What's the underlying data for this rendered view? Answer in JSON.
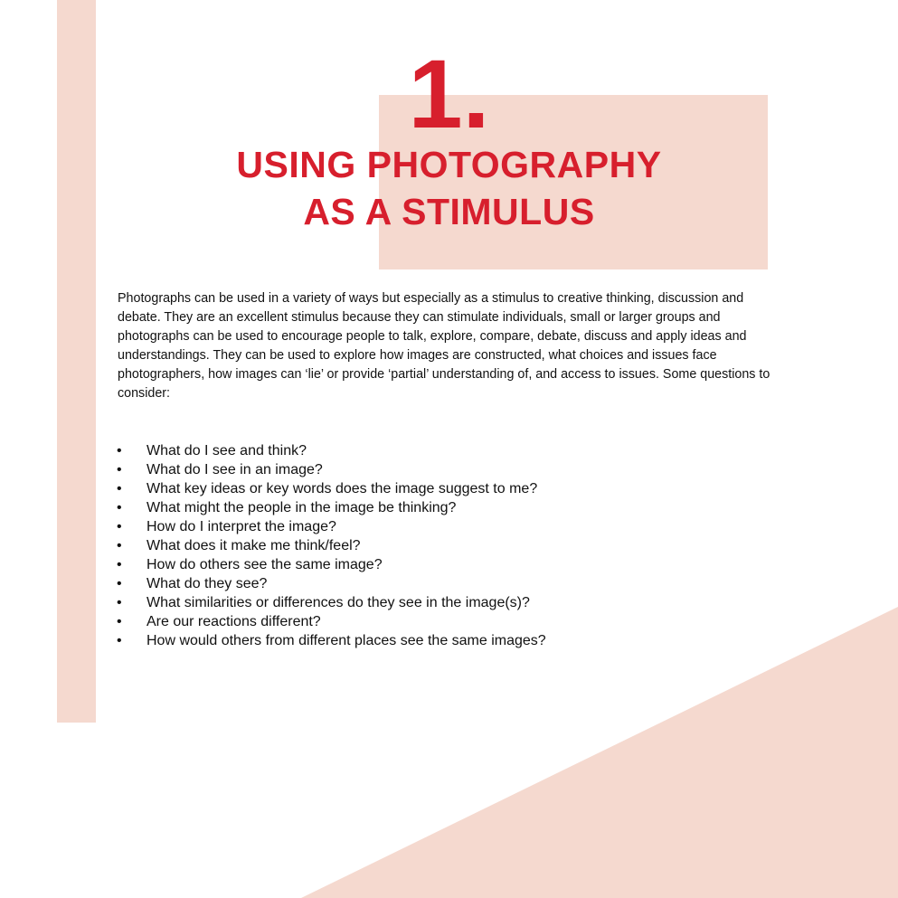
{
  "colors": {
    "accent_red": "#d71f2d",
    "accent_bg": "#f5d9cf",
    "text": "#111111",
    "background": "#ffffff"
  },
  "heading": {
    "number": "1.",
    "line1": "USING PHOTOGRAPHY",
    "line2": "AS A STIMULUS"
  },
  "intro": "Photographs can be used in a variety of ways but especially as a stimulus to creative thinking, discussion and debate. They are an excellent stimulus because they can stimulate individuals, small or larger groups and photographs can be used to encourage people to talk, explore, compare, debate, discuss and apply ideas and understandings. They can be used to explore how images are constructed, what choices and issues face photographers, how images can ‘lie’ or provide ‘partial’ understanding of, and access to issues. Some questions to consider:",
  "bullet_symbol": "•",
  "questions": [
    "What do I see and think?",
    "What do I see in an image?",
    "What key ideas or key words does the image suggest to me?",
    "What might the people in the image be thinking?",
    "How do I interpret the image?",
    "What does it make me think/feel?",
    "How do others see the same image?",
    "What do they see?",
    "What similarities or differences do they see in the image(s)?",
    "Are our reactions different?",
    "How would others from different places see the same images?"
  ]
}
